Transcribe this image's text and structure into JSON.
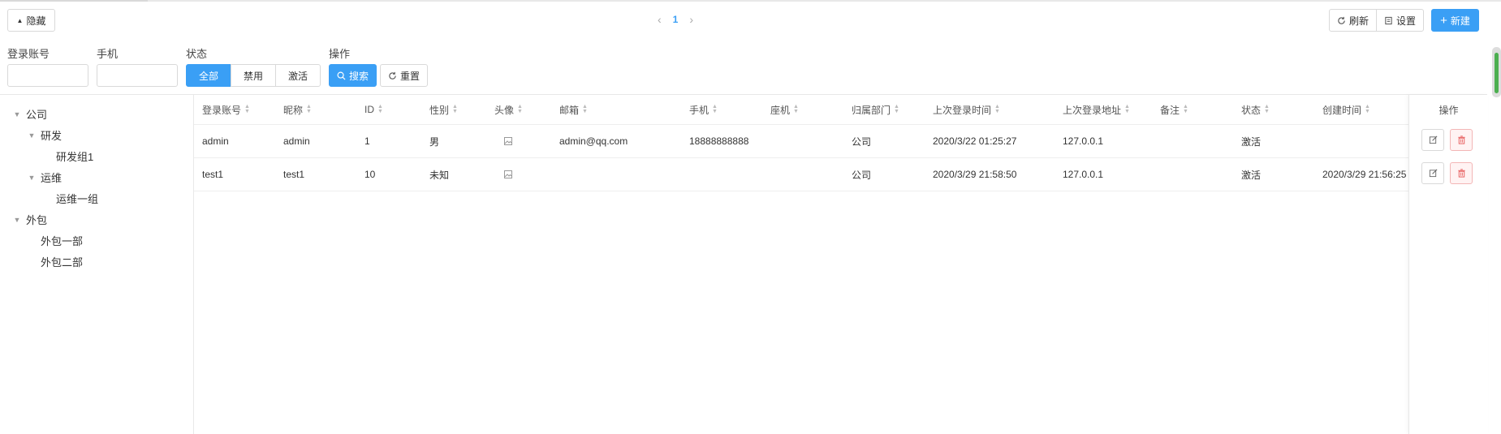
{
  "toolbar": {
    "hide_label": "隐藏",
    "refresh_label": "刷新",
    "settings_label": "设置",
    "new_label": "新建"
  },
  "pager": {
    "current_page": "1"
  },
  "filters": {
    "account_label": "登录账号",
    "phone_label": "手机",
    "status_label": "状态",
    "status_options": [
      "全部",
      "禁用",
      "激活"
    ],
    "actions_label": "操作",
    "search_label": "搜索",
    "reset_label": "重置"
  },
  "tree": {
    "root1": "公司",
    "dev": "研发",
    "dev_group1": "研发组1",
    "ops": "运维",
    "ops_group1": "运维一组",
    "root2": "外包",
    "outsource1": "外包一部",
    "outsource2": "外包二部"
  },
  "table": {
    "columns": [
      "登录账号",
      "昵称",
      "ID",
      "性别",
      "头像",
      "邮箱",
      "手机",
      "座机",
      "归属部门",
      "上次登录时间",
      "上次登录地址",
      "备注",
      "状态",
      "创建时间"
    ],
    "ops_header": "操作",
    "rows": [
      [
        "admin",
        "admin",
        "1",
        "男",
        "",
        "admin@qq.com",
        "18888888888",
        "",
        "公司",
        "2020/3/22 01:25:27",
        "127.0.0.1",
        "",
        "激活",
        ""
      ],
      [
        "test1",
        "test1",
        "10",
        "未知",
        "",
        "",
        "",
        "",
        "公司",
        "2020/3/29 21:58:50",
        "127.0.0.1",
        "",
        "激活",
        "2020/3/29 21:56:25"
      ]
    ]
  },
  "colors": {
    "primary": "#3a9ff5",
    "danger": "#e86464"
  }
}
